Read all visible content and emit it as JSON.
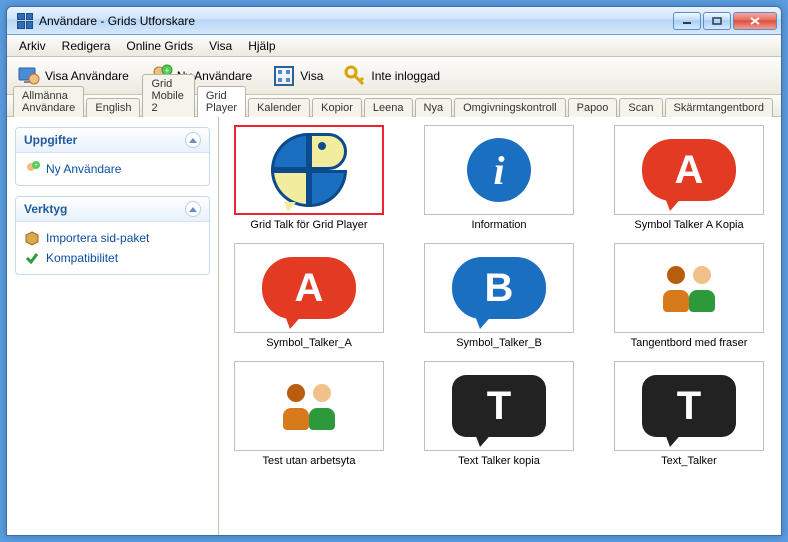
{
  "window": {
    "title": "Användare - Grids Utforskare"
  },
  "menu": {
    "items": [
      "Arkiv",
      "Redigera",
      "Online Grids",
      "Visa",
      "Hjälp"
    ]
  },
  "toolbar": {
    "view_users": "Visa Användare",
    "new_user": "Ny Användare",
    "view": "Visa",
    "not_logged_in": "Inte inloggad"
  },
  "tabs": {
    "items": [
      "Allmänna Användare",
      "English",
      "Grid Mobile 2",
      "Grid Player",
      "Kalender",
      "Kopior",
      "Leena",
      "Nya",
      "Omgivningskontroll",
      "Papoo",
      "Scan",
      "Skärmtangentbord"
    ],
    "active_index": 3
  },
  "sidebar": {
    "tasks": {
      "title": "Uppgifter",
      "new_user": "Ny Användare"
    },
    "tools": {
      "title": "Verktyg",
      "import": "Importera sid-paket",
      "compat": "Kompatibilitet"
    }
  },
  "grid": {
    "items": [
      {
        "label": "Grid Talk för Grid Player",
        "icon": "gridtalk",
        "selected": true
      },
      {
        "label": "Information",
        "icon": "info"
      },
      {
        "label": "Symbol Talker A Kopia",
        "icon": "bubble-red-A"
      },
      {
        "label": "Symbol_Talker_A",
        "icon": "bubble-red-A"
      },
      {
        "label": "Symbol_Talker_B",
        "icon": "bubble-blue-B"
      },
      {
        "label": "Tangentbord med fraser",
        "icon": "people"
      },
      {
        "label": "Test utan arbetsyta",
        "icon": "people"
      },
      {
        "label": "Text Talker kopia",
        "icon": "bubble-black-T"
      },
      {
        "label": "Text_Talker",
        "icon": "bubble-black-T"
      }
    ]
  }
}
